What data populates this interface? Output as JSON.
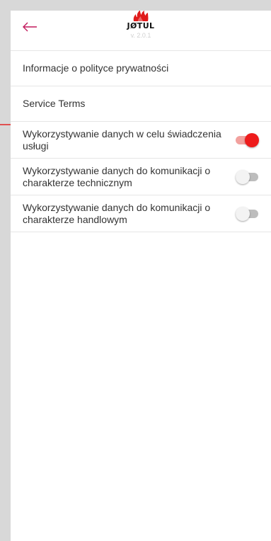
{
  "header": {
    "back_icon": "arrow-left-icon",
    "logo_icon": "flame-icon",
    "brand": "JØTUL",
    "version": "v. 2.0.1",
    "colors": {
      "brand_red": "#e01b1b",
      "back_arrow": "#c2185b"
    }
  },
  "menu": {
    "privacy_info": "Informacje o polityce prywatności",
    "service_terms": "Service Terms"
  },
  "consents": [
    {
      "label": "Wykorzystywanie danych w celu świadczenia usługi",
      "enabled": true
    },
    {
      "label": "Wykorzystywanie danych do komunikacji o charakterze technicznym",
      "enabled": false
    },
    {
      "label": "Wykorzystywanie danych do komunikacji o charakterze handlowym",
      "enabled": false
    }
  ],
  "colors": {
    "toggle_on_thumb": "#ee1c1c",
    "toggle_on_track": "#f2a19e",
    "toggle_off_thumb": "#f3f3f3",
    "toggle_off_track": "#bdbdbd",
    "annotation_arrow": "#e32222"
  },
  "annotation": {
    "icon": "arrow-right-icon"
  }
}
